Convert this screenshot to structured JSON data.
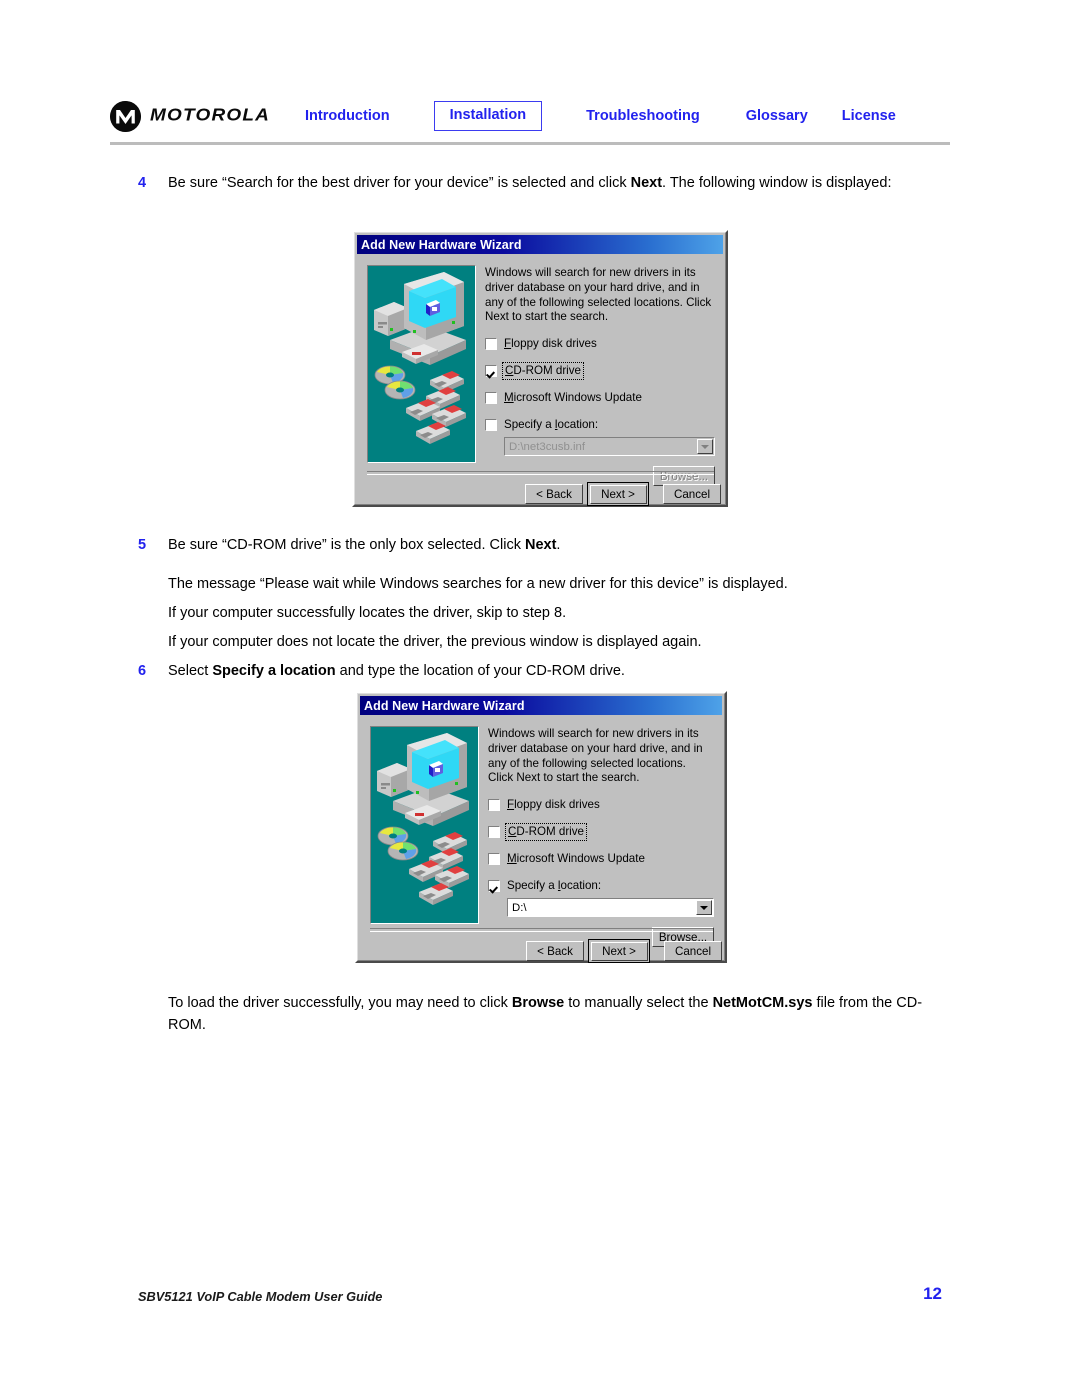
{
  "header": {
    "brand": "MOTOROLA",
    "nav": [
      {
        "label": "Introduction",
        "active": false
      },
      {
        "label": "Installation",
        "active": true
      },
      {
        "label": "Troubleshooting",
        "active": false
      },
      {
        "label": "Glossary",
        "active": false
      },
      {
        "label": "License",
        "active": false
      }
    ],
    "accent_color": "#2222ee"
  },
  "content": {
    "step4": {
      "number": "4",
      "text_a": "Be sure “Search for the best driver for your device” is selected and click ",
      "bold": "Next",
      "text_b": ". The following window is displayed:"
    },
    "step5": {
      "number": "5",
      "text_a": "Be sure “CD-ROM drive” is the only box selected. Click ",
      "bold": "Next",
      "text_b": "."
    },
    "para_wait": "The message “Please wait while Windows searches for a new driver for this device” is displayed.",
    "para_success": "If your computer successfully locates the driver, skip to step 8.",
    "para_fail": "If your computer does not locate the driver, the previous window is displayed again.",
    "step6": {
      "number": "6",
      "text_a": "Select ",
      "bold": "Specify a location",
      "text_b": " and type the location of your CD-ROM drive."
    },
    "para_browse": {
      "text_a": "To load the driver successfully, you may need to click ",
      "bold_a": "Browse",
      "text_b": " to manually select the ",
      "bold_b": "NetMotCM.sys",
      "text_c": " file from the CD-ROM."
    }
  },
  "dialog1": {
    "title": "Add New Hardware Wizard",
    "description": "Windows will search for new drivers in its driver database on your hard drive, and in any of the following selected locations. Click Next to start the search.",
    "checkboxes": [
      {
        "label": "Floppy disk drives",
        "mnemonic": "F",
        "checked": false,
        "focused": false,
        "disabled": false
      },
      {
        "label": "CD-ROM drive",
        "mnemonic": "C",
        "checked": true,
        "focused": true,
        "disabled": false
      },
      {
        "label": "Microsoft Windows Update",
        "mnemonic": "M",
        "checked": false,
        "focused": false,
        "disabled": false
      },
      {
        "label": "Specify a location:",
        "mnemonic": "l",
        "checked": false,
        "focused": false,
        "disabled": false
      }
    ],
    "location_value": "D:\\net3cusb.inf",
    "location_disabled": true,
    "browse_label": "Browse...",
    "browse_disabled": true,
    "buttons": {
      "back": "< Back",
      "next": "Next >",
      "cancel": "Cancel",
      "default": "next"
    }
  },
  "dialog2": {
    "title": "Add New Hardware Wizard",
    "description": "Windows will search for new drivers in its driver database on your hard drive, and in any of the following selected locations. Click Next to start the search.",
    "checkboxes": [
      {
        "label": "Floppy disk drives",
        "mnemonic": "F",
        "checked": false,
        "focused": false,
        "disabled": false
      },
      {
        "label": "CD-ROM drive",
        "mnemonic": "C",
        "checked": false,
        "focused": true,
        "disabled": false
      },
      {
        "label": "Microsoft Windows Update",
        "mnemonic": "M",
        "checked": false,
        "focused": false,
        "disabled": false
      },
      {
        "label": "Specify a location:",
        "mnemonic": "l",
        "checked": true,
        "focused": false,
        "disabled": false
      }
    ],
    "location_value": "D:\\",
    "location_disabled": false,
    "browse_label": "Browse...",
    "browse_disabled": false,
    "buttons": {
      "back": "< Back",
      "next": "Next >",
      "cancel": "Cancel",
      "default": "next"
    }
  },
  "footer": {
    "document_title": "SBV5121 VoIP Cable Modem User Guide",
    "page_number": "12"
  }
}
